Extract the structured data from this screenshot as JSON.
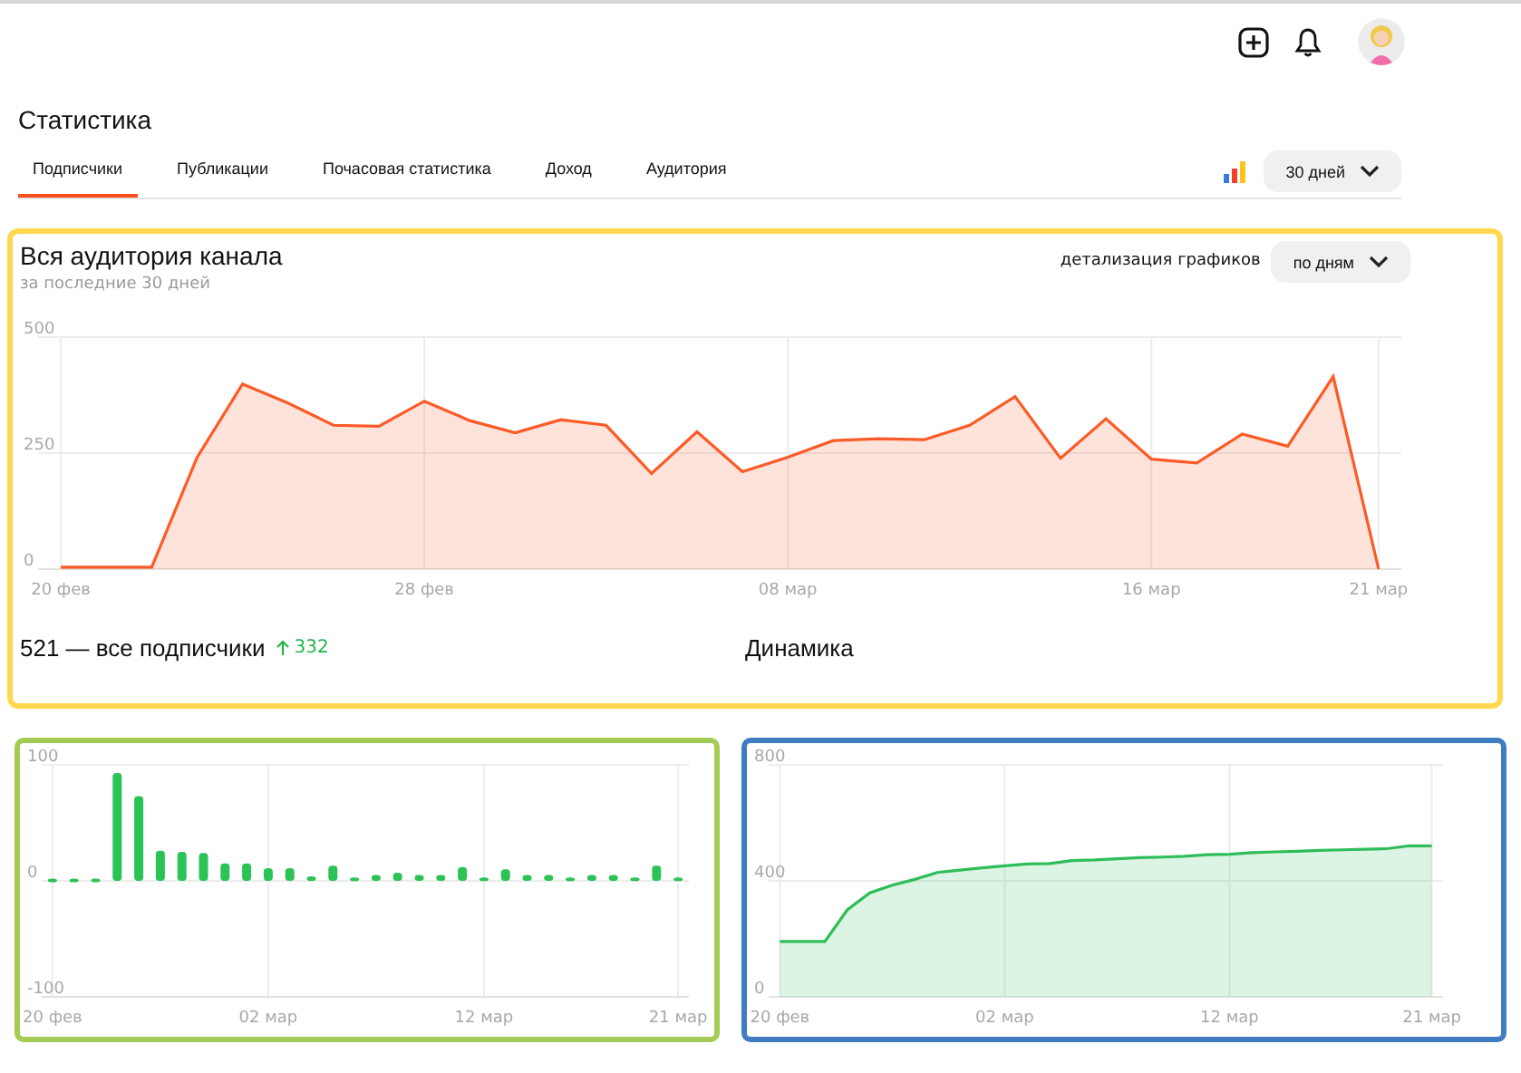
{
  "page_title": "Статистика",
  "tabs": [
    {
      "label": "Подписчики",
      "selected": true
    },
    {
      "label": "Публикации",
      "selected": false
    },
    {
      "label": "Почасовая статистика",
      "selected": false
    },
    {
      "label": "Доход",
      "selected": false
    },
    {
      "label": "Аудитория",
      "selected": false
    }
  ],
  "period_dropdown": {
    "value": "30 дней"
  },
  "audience_panel": {
    "title": "Вся аудитория канала",
    "subtitle": "за последние 30 дней",
    "detail_label": "детализация графиков",
    "detail_dropdown": {
      "value": "по дням"
    },
    "chart_data": {
      "type": "area",
      "grid": true,
      "ylim": [
        0,
        500
      ],
      "yticks": [
        0,
        250,
        500
      ],
      "categories": [
        "20 фев",
        null,
        null,
        null,
        null,
        null,
        null,
        null,
        "28 фев",
        null,
        null,
        null,
        null,
        null,
        null,
        null,
        "08 мар",
        null,
        null,
        null,
        null,
        null,
        null,
        null,
        "16 мар",
        null,
        null,
        null,
        null,
        "21 мар"
      ],
      "series": [
        {
          "color": "#fc5a26",
          "values": [
            4,
            4,
            4,
            241,
            399,
            358,
            310,
            308,
            362,
            320,
            294,
            322,
            310,
            206,
            296,
            210,
            241,
            277,
            281,
            279,
            310,
            372,
            239,
            324,
            237,
            229,
            291,
            265,
            415,
            0
          ]
        }
      ]
    }
  },
  "subscribers": {
    "title": "521 — все подписчики",
    "delta": "332",
    "chart_data": {
      "type": "bar",
      "grid": true,
      "ylim": [
        -100,
        100
      ],
      "yticks": [
        -100,
        0,
        100
      ],
      "categories": [
        "20 фев",
        null,
        null,
        null,
        null,
        null,
        null,
        null,
        null,
        null,
        "02 мар",
        null,
        null,
        null,
        null,
        null,
        null,
        null,
        null,
        null,
        "12 мар",
        null,
        null,
        null,
        null,
        null,
        null,
        null,
        null,
        "21 мар"
      ],
      "series": [
        {
          "color": "#2bc256",
          "values": [
            2,
            2,
            2,
            93,
            73,
            26,
            25,
            24,
            15,
            15,
            11,
            11,
            4,
            13,
            3,
            5,
            7,
            5,
            5,
            12,
            3,
            10,
            5,
            5,
            3,
            5,
            5,
            3,
            13,
            3
          ]
        }
      ]
    }
  },
  "dynamics": {
    "title": "Динамика",
    "chart_data": {
      "type": "area",
      "grid": true,
      "ylim": [
        0,
        800
      ],
      "yticks": [
        0,
        400,
        800
      ],
      "categories": [
        "20 фев",
        null,
        null,
        null,
        null,
        null,
        null,
        null,
        null,
        null,
        "02 мар",
        null,
        null,
        null,
        null,
        null,
        null,
        null,
        null,
        null,
        "12 мар",
        null,
        null,
        null,
        null,
        null,
        null,
        null,
        null,
        "21 мар"
      ],
      "series": [
        {
          "color": "#2ebd59",
          "values": [
            191,
            191,
            191,
            300,
            359,
            385,
            405,
            429,
            437,
            445,
            452,
            458,
            460,
            470,
            472,
            476,
            480,
            482,
            485,
            490,
            492,
            497,
            500,
            502,
            505,
            507,
            509,
            511,
            521,
            521
          ]
        }
      ]
    }
  }
}
